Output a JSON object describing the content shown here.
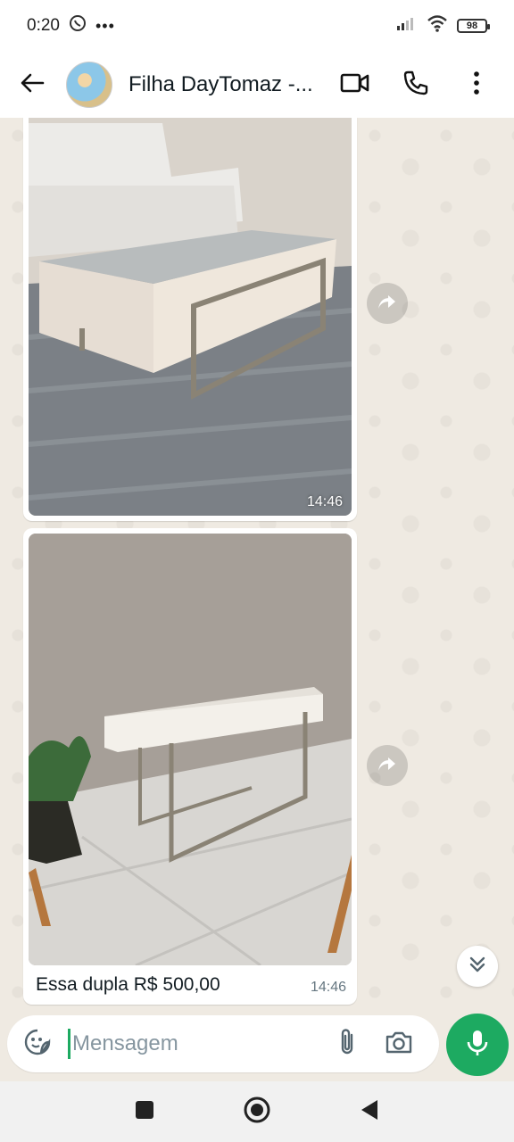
{
  "status_bar": {
    "time": "0:20",
    "battery": "98"
  },
  "header": {
    "contact_name": "Filha DayTomaz -..."
  },
  "messages": [
    {
      "type": "image",
      "time": "14:46",
      "photo": "coffee-table"
    },
    {
      "type": "image",
      "time": "14:46",
      "photo": "console-table",
      "caption": "Essa dupla R$ 500,00"
    }
  ],
  "composer": {
    "placeholder": "Mensagem"
  },
  "colors": {
    "accent": "#1daa61",
    "chat_background": "#efeae2",
    "bubble": "#ffffff"
  },
  "icons": [
    "back-arrow-icon",
    "video-call-icon",
    "phone-call-icon",
    "more-options-icon",
    "forward-icon",
    "double-chevron-down-icon",
    "sticker-icon",
    "attach-icon",
    "camera-icon",
    "microphone-icon"
  ]
}
